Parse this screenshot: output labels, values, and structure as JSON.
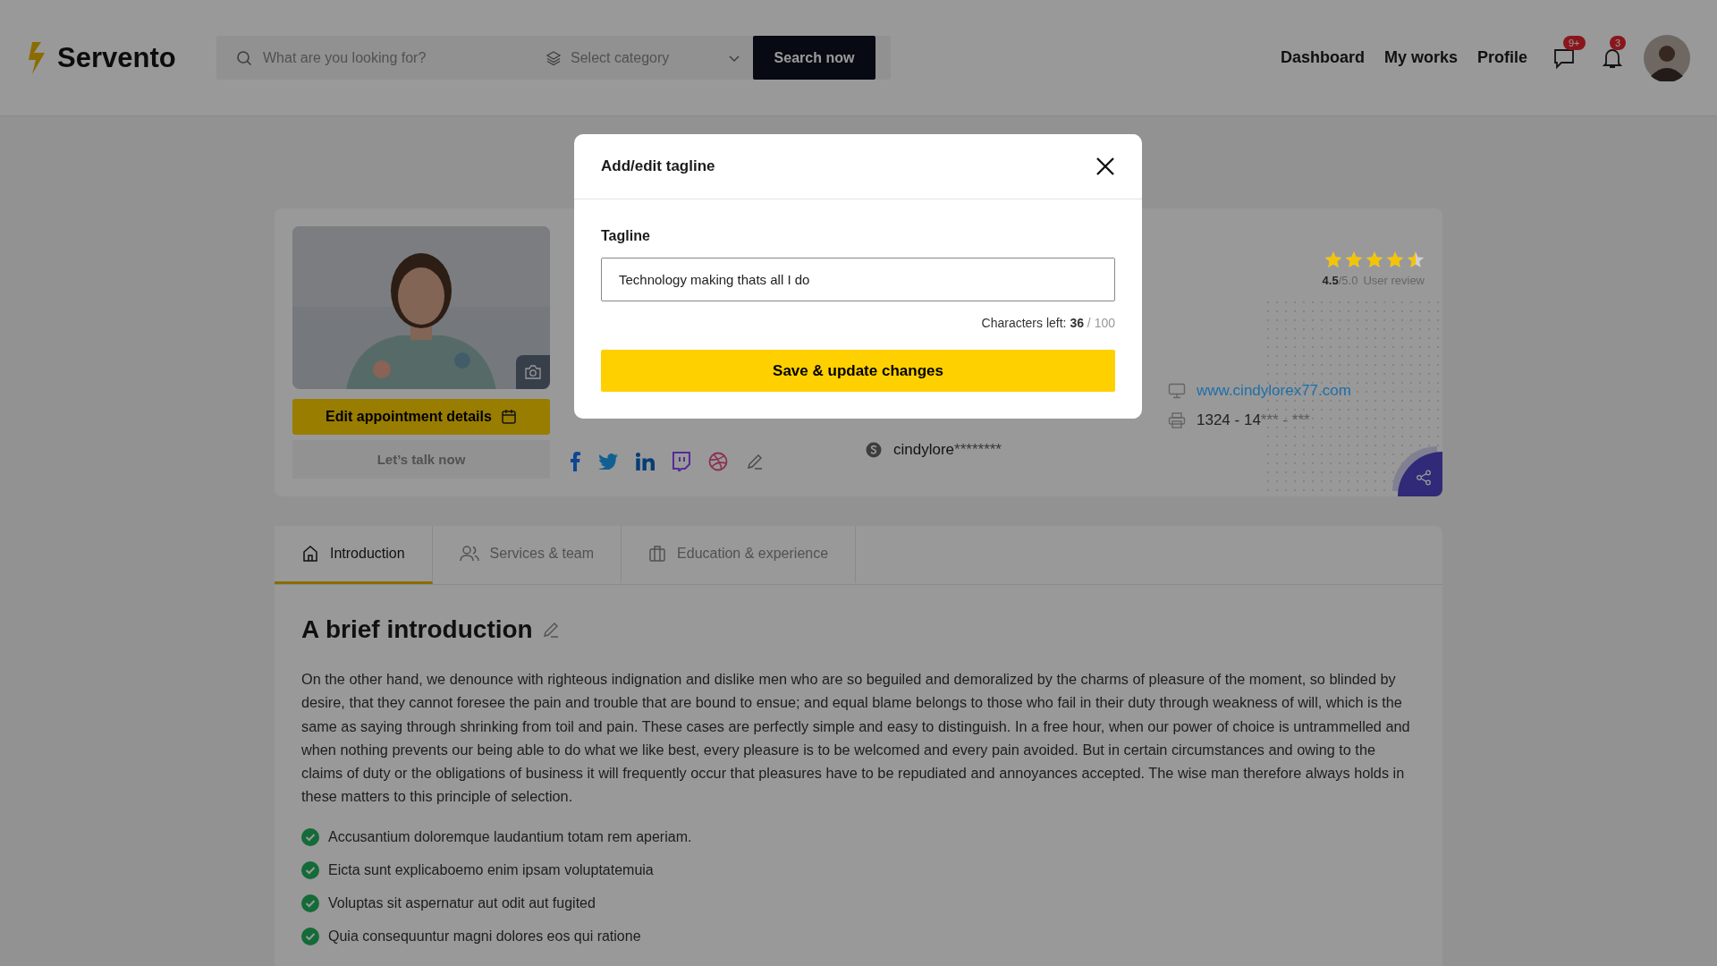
{
  "header": {
    "logo": "Servento",
    "search_placeholder": "What are you looking for?",
    "category_placeholder": "Select category",
    "search_button": "Search now",
    "nav": [
      "Dashboard",
      "My works",
      "Profile"
    ],
    "messages_badge": "9+",
    "notifications_badge": "3"
  },
  "profile": {
    "edit_button": "Edit appointment details",
    "talk_button": "Let’s talk now",
    "socials": [
      {
        "kind": "facebook"
      },
      {
        "kind": "twitter"
      },
      {
        "kind": "linkedin"
      },
      {
        "kind": "twitch"
      },
      {
        "kind": "dribbble"
      },
      {
        "kind": "edit"
      }
    ],
    "skype": {
      "visible": "cindylore",
      "masked": "********"
    },
    "website": "www.cindylorex77.com",
    "phone": {
      "visible": "1324 - 14",
      "masked": "*** - ***"
    },
    "rating": {
      "stars": 4.5,
      "score": "4.5",
      "out_of": "/5.0",
      "label": "User review"
    }
  },
  "tabs": [
    {
      "label": "Introduction",
      "selected": true
    },
    {
      "label": "Services & team",
      "selected": false
    },
    {
      "label": "Education & experience",
      "selected": false
    }
  ],
  "intro": {
    "heading": "A brief introduction",
    "paragraph": "On the other hand, we denounce with righteous indignation and dislike men who are so beguiled and demoralized by the charms of pleasure of the moment, so blinded by desire, that they cannot foresee the pain and trouble that are bound to ensue; and equal blame belongs to those who fail in their duty through weakness of will, which is the same as saying through shrinking from toil and pain. These cases are perfectly simple and easy to distinguish. In a free hour, when our power of choice is untrammelled and when nothing prevents our being able to do what we like best, every pleasure is to be welcomed and every pain avoided. But in certain circumstances and owing to the claims of duty or the obligations of business it will frequently occur that pleasures have to be repudiated and annoyances accepted. The wise man therefore always holds in these matters to this principle of selection.",
    "checklist": [
      "Accusantium doloremque laudantium totam rem aperiam.",
      "Eicta sunt explicaboemo enim ipsam voluptatemuia",
      "Voluptas sit aspernatur aut odit aut fugited",
      "Quia consequuntur magni dolores eos qui ratione"
    ]
  },
  "modal": {
    "title": "Add/edit tagline",
    "field_label": "Tagline",
    "value": "Technology making thats all I do",
    "counter_label": "Characters left:",
    "count": "36",
    "max": "/ 100",
    "button": "Save & update changes"
  }
}
